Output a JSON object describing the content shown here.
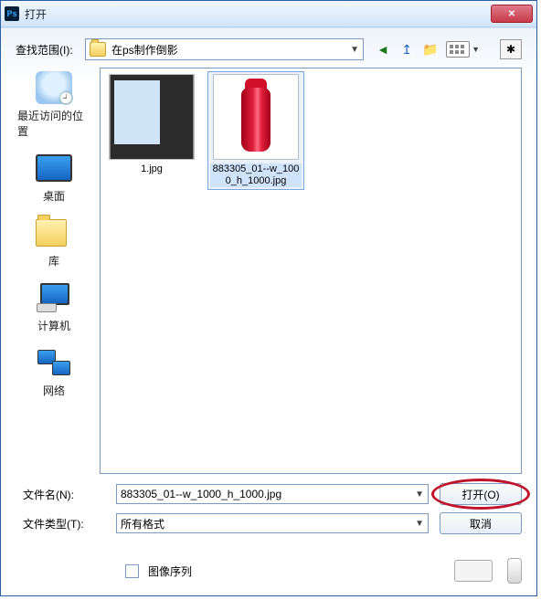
{
  "window": {
    "title": "打开",
    "close_glyph": "✕"
  },
  "lookin": {
    "label": "查找范围(I):",
    "value": "在ps制作倒影",
    "back_glyph": "◄",
    "up_glyph": "↥",
    "newfolder_glyph": "📁",
    "bookmark_glyph": "✱"
  },
  "places": {
    "recent": "最近访问的位置",
    "desktop": "桌面",
    "libraries": "库",
    "computer": "计算机",
    "network": "网络"
  },
  "files": {
    "items": [
      {
        "name": "1.jpg",
        "selected": false,
        "kind": "ps"
      },
      {
        "name": "883305_01--w_1000_h_1000.jpg",
        "selected": true,
        "kind": "bottle"
      }
    ]
  },
  "filename": {
    "label": "文件名(N):",
    "value": "883305_01--w_1000_h_1000.jpg"
  },
  "filetype": {
    "label": "文件类型(T):",
    "value": "所有格式"
  },
  "buttons": {
    "open": "打开(O)",
    "cancel": "取消"
  },
  "sequence": {
    "label": "图像序列",
    "checked": false
  }
}
